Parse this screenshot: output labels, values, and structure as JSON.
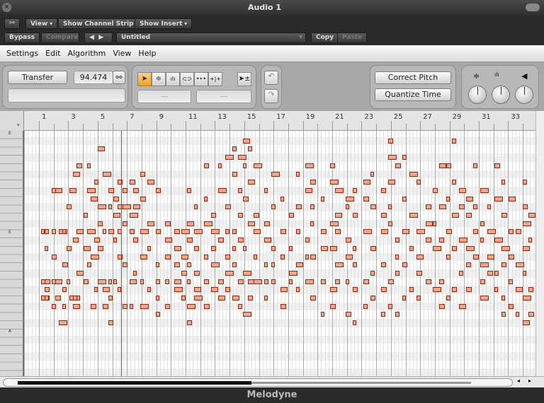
{
  "window": {
    "title": "Audio 1"
  },
  "toolbar": {
    "link_icon": "link-icon",
    "view": "View",
    "show_channel_strip": "Show Channel Strip",
    "show_insert": "Show Insert",
    "bypass": "Bypass",
    "compare": "Compare",
    "preset": "Untitled",
    "copy": "Copy",
    "paste": "Paste"
  },
  "menu": [
    "Settings",
    "Edit",
    "Algorithm",
    "View",
    "Help"
  ],
  "controls": {
    "transfer": "Transfer",
    "tempo": "94.474",
    "field1": "---",
    "field2": "---",
    "correct_pitch": "Correct Pitch",
    "quantize_time": "Quantize Time",
    "tools": [
      "main-tool-icon",
      "pitch-tool-icon",
      "formant-tool-icon",
      "amplitude-tool-icon",
      "timing-tool-icon",
      "note-separation-tool-icon"
    ],
    "tool_glyphs": [
      "➤",
      "≑",
      "ılı",
      "⊂⊃",
      "•‣•",
      "+|+"
    ]
  },
  "ruler": {
    "labels": [
      "1",
      "3",
      "5",
      "7",
      "9",
      "11",
      "13",
      "15",
      "17",
      "19",
      "21",
      "23",
      "25",
      "27",
      "29",
      "31",
      "33"
    ]
  },
  "keys": {
    "labels": [
      "E",
      "E",
      "A"
    ]
  },
  "editor": {
    "playhead_bar": 6.6,
    "note_color": "#f3a68a",
    "notes": [
      [
        1.24,
        [
          12,
          18,
          20
        ]
      ],
      [
        1.48,
        [
          12,
          14,
          18,
          19,
          20
        ]
      ],
      [
        1.97,
        [
          7,
          12,
          15,
          18,
          21
        ]
      ],
      [
        2.21,
        [
          7,
          18,
          20
        ]
      ],
      [
        2.45,
        [
          12,
          23
        ]
      ],
      [
        2.69,
        [
          12,
          16,
          19,
          21
        ]
      ],
      [
        2.98,
        [
          9,
          14,
          18
        ]
      ],
      [
        3.17,
        [
          7,
          20
        ]
      ],
      [
        3.42,
        [
          5,
          13,
          21,
          20
        ]
      ],
      [
        3.66,
        [
          4,
          12,
          17,
          20
        ]
      ],
      [
        4.14,
        [
          10,
          14,
          18
        ]
      ],
      [
        4.38,
        [
          4,
          7,
          12,
          16
        ]
      ],
      [
        4.62,
        [
          8,
          15,
          21
        ]
      ],
      [
        4.86,
        [
          6,
          13,
          19
        ]
      ],
      [
        5.11,
        [
          2,
          9,
          11,
          14,
          18
        ]
      ],
      [
        5.44,
        [
          5,
          12,
          19,
          21
        ]
      ],
      [
        5.83,
        [
          9,
          7,
          12,
          18,
          20,
          23
        ]
      ],
      [
        6.17,
        [
          8,
          10,
          13,
          18
        ]
      ],
      [
        6.46,
        [
          6,
          9,
          12,
          15,
          19
        ]
      ],
      [
        6.8,
        [
          7,
          9,
          11,
          16,
          21
        ]
      ],
      [
        7.28,
        [
          6,
          10,
          12,
          18,
          21
        ]
      ],
      [
        7.52,
        [
          7,
          9,
          13,
          17
        ]
      ],
      [
        8.0,
        [
          5,
          8,
          12,
          15,
          18,
          21
        ]
      ],
      [
        8.49,
        [
          6,
          11,
          14,
          19
        ]
      ],
      [
        9.07,
        [
          7,
          12,
          16,
          18,
          20,
          22
        ]
      ],
      [
        9.7,
        [
          11,
          13,
          15,
          18,
          21
        ]
      ],
      [
        10.32,
        [
          12,
          14,
          16,
          18,
          19
        ]
      ],
      [
        10.81,
        [
          12,
          15,
          17,
          20
        ]
      ],
      [
        11.19,
        [
          7,
          11,
          13,
          16,
          18,
          21,
          23
        ]
      ],
      [
        11.68,
        [
          9,
          12,
          14,
          17,
          19,
          20
        ]
      ],
      [
        12.35,
        [
          4,
          8,
          11,
          15,
          18,
          21
        ]
      ],
      [
        12.84,
        [
          10,
          12,
          14,
          16,
          19
        ]
      ],
      [
        13.32,
        [
          4,
          7,
          13,
          18,
          20
        ]
      ],
      [
        13.8,
        [
          3,
          9,
          12,
          15,
          17,
          19
        ]
      ],
      [
        14.29,
        [
          2,
          5,
          12,
          14,
          16,
          20
        ]
      ],
      [
        14.67,
        [
          3,
          7,
          10,
          13,
          18,
          21
        ]
      ],
      [
        15.01,
        [
          1,
          4,
          8,
          14,
          17,
          22
        ]
      ],
      [
        15.35,
        [
          2,
          6,
          11,
          18,
          20
        ]
      ],
      [
        15.73,
        [
          4,
          10,
          12,
          15,
          18
        ]
      ],
      [
        16.46,
        [
          7,
          11,
          13,
          16,
          18,
          20
        ]
      ],
      [
        16.94,
        [
          5,
          9,
          14,
          16,
          18
        ]
      ],
      [
        17.57,
        [
          8,
          12,
          15,
          19,
          21
        ]
      ],
      [
        18.15,
        [
          10,
          14,
          17,
          18
        ]
      ],
      [
        18.63,
        [
          5,
          9,
          12,
          16,
          19
        ]
      ],
      [
        19.26,
        [
          4,
          7,
          13,
          15,
          18
        ]
      ],
      [
        19.6,
        [
          6,
          9,
          11,
          15,
          20
        ]
      ],
      [
        20.32,
        [
          8,
          12,
          14,
          18,
          22
        ]
      ],
      [
        20.95,
        [
          4,
          6,
          11,
          14,
          19,
          21
        ]
      ],
      [
        21.29,
        [
          7,
          10,
          12,
          16,
          18
        ]
      ],
      [
        22.01,
        [
          8,
          9,
          13,
          15,
          18,
          22
        ]
      ],
      [
        22.5,
        [
          7,
          10,
          14,
          16,
          19,
          23
        ]
      ],
      [
        23.22,
        [
          6,
          8,
          12,
          18,
          21
        ]
      ],
      [
        23.71,
        [
          5,
          9,
          14,
          17,
          20
        ]
      ],
      [
        24.43,
        [
          7,
          10,
          12,
          16,
          19,
          22
        ]
      ],
      [
        24.91,
        [
          1,
          3,
          6,
          9,
          11,
          18,
          21
        ]
      ],
      [
        25.4,
        [
          4,
          13,
          15,
          17,
          22
        ]
      ],
      [
        25.88,
        [
          3,
          8,
          12,
          16,
          20
        ]
      ],
      [
        26.36,
        [
          5,
          10,
          14,
          19
        ]
      ],
      [
        26.85,
        [
          6,
          12,
          15,
          17,
          20
        ]
      ],
      [
        27.47,
        [
          9,
          11,
          13,
          18
        ]
      ],
      [
        27.96,
        [
          7,
          11,
          14,
          19
        ]
      ],
      [
        28.39,
        [
          4,
          9,
          13,
          18,
          21
        ]
      ],
      [
        28.87,
        [
          4,
          8,
          12,
          15,
          20
        ]
      ],
      [
        29.26,
        [
          1,
          6,
          10,
          14,
          19
        ]
      ],
      [
        29.74,
        [
          7,
          9,
          13,
          17,
          21
        ]
      ],
      [
        30.23,
        [
          8,
          10,
          14,
          16,
          19
        ]
      ],
      [
        30.71,
        [
          4,
          9,
          12,
          15
        ]
      ],
      [
        31.19,
        [
          7,
          11,
          13,
          16,
          18,
          20
        ]
      ],
      [
        31.68,
        [
          9,
          12,
          15,
          17
        ]
      ],
      [
        32.16,
        [
          4,
          8,
          13,
          17,
          19
        ]
      ],
      [
        32.64,
        [
          6,
          10,
          14,
          16,
          20,
          22
        ]
      ],
      [
        33.13,
        [
          8,
          12,
          15,
          18,
          21
        ]
      ],
      [
        33.61,
        [
          12,
          16,
          19,
          22
        ]
      ],
      [
        34.09,
        [
          6,
          9,
          11,
          14,
          17,
          20,
          23
        ]
      ],
      [
        34.48,
        [
          10,
          13,
          19,
          22
        ]
      ]
    ]
  },
  "footer": {
    "brand": "Melodyne"
  }
}
